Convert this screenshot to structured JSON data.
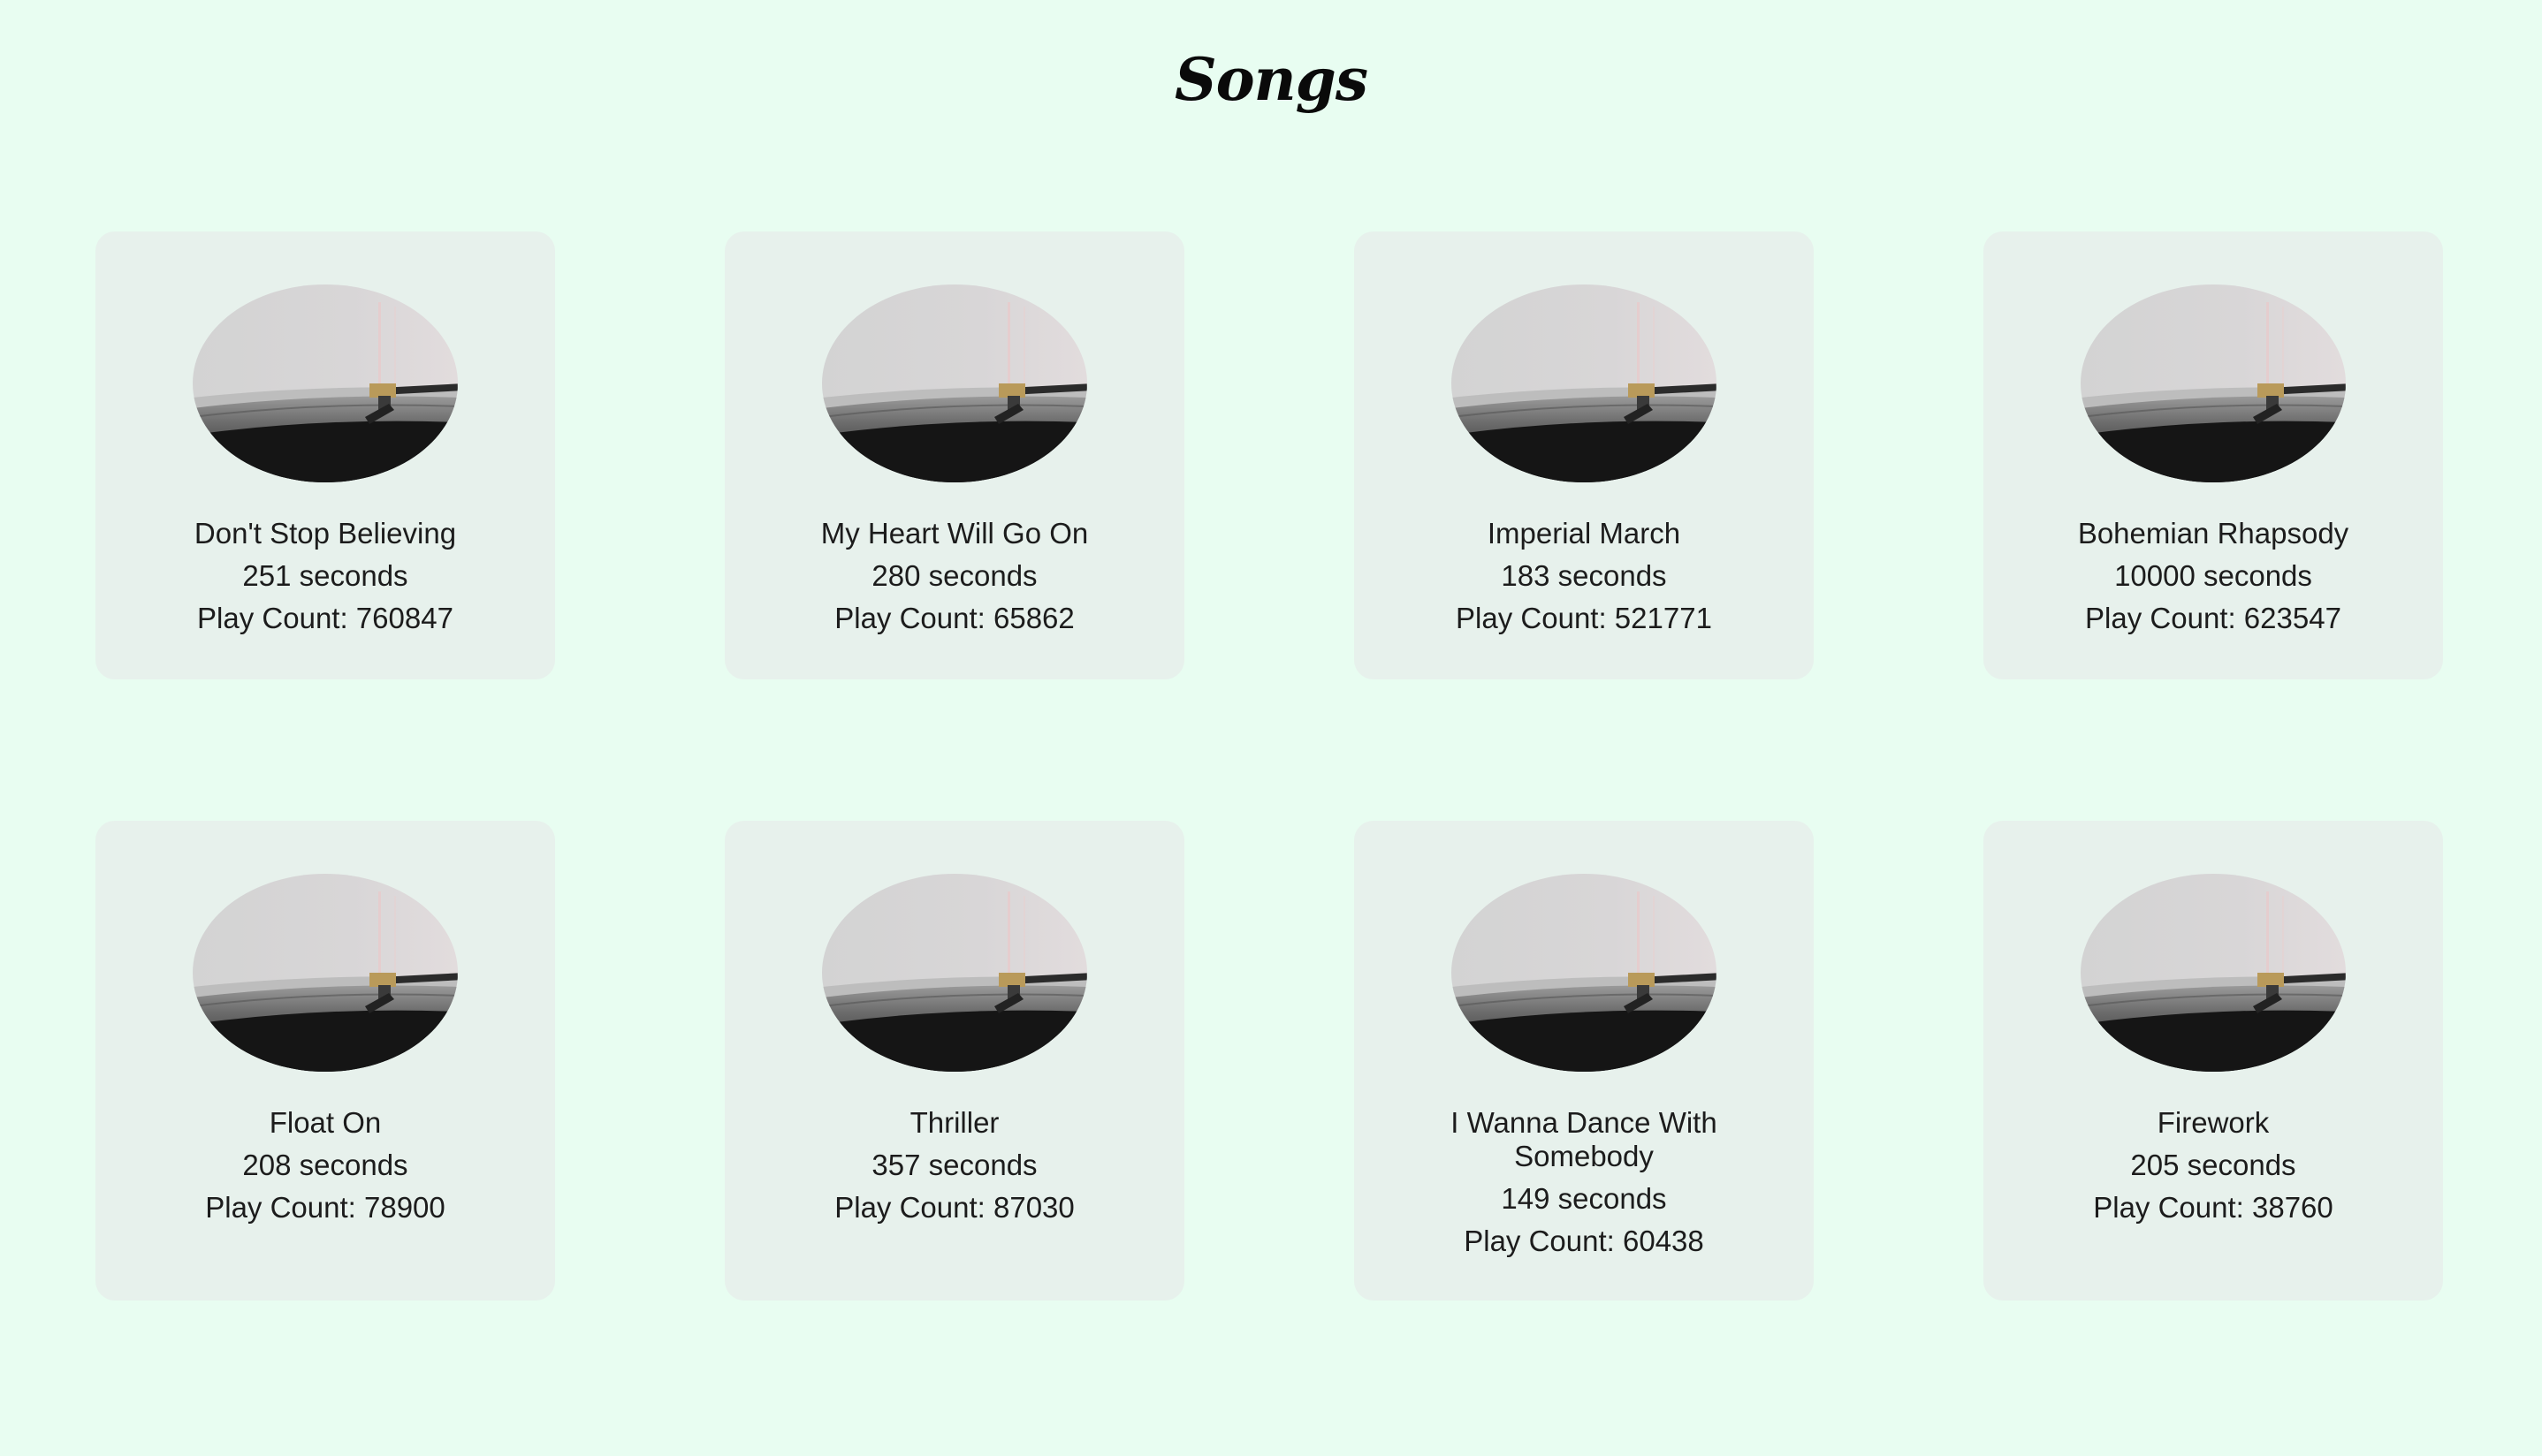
{
  "page": {
    "title": "Songs"
  },
  "colors": {
    "background": "#e8fdf1",
    "card": "#e7f1ec",
    "text": "#1c1c1c"
  },
  "album_art_icon": "turntable-vinyl-photo",
  "songs": [
    {
      "name": "Don't Stop Believing",
      "duration": "251 seconds",
      "play_count": "Play Count: 760847"
    },
    {
      "name": "My Heart Will Go On",
      "duration": "280 seconds",
      "play_count": "Play Count: 65862"
    },
    {
      "name": "Imperial March",
      "duration": "183 seconds",
      "play_count": "Play Count: 521771"
    },
    {
      "name": "Bohemian Rhapsody",
      "duration": "10000 seconds",
      "play_count": "Play Count: 623547"
    },
    {
      "name": "Float On",
      "duration": "208 seconds",
      "play_count": "Play Count: 78900"
    },
    {
      "name": "Thriller",
      "duration": "357 seconds",
      "play_count": "Play Count: 87030"
    },
    {
      "name": "I Wanna Dance With Somebody",
      "duration": "149 seconds",
      "play_count": "Play Count: 60438"
    },
    {
      "name": "Firework",
      "duration": "205 seconds",
      "play_count": "Play Count: 38760"
    }
  ]
}
